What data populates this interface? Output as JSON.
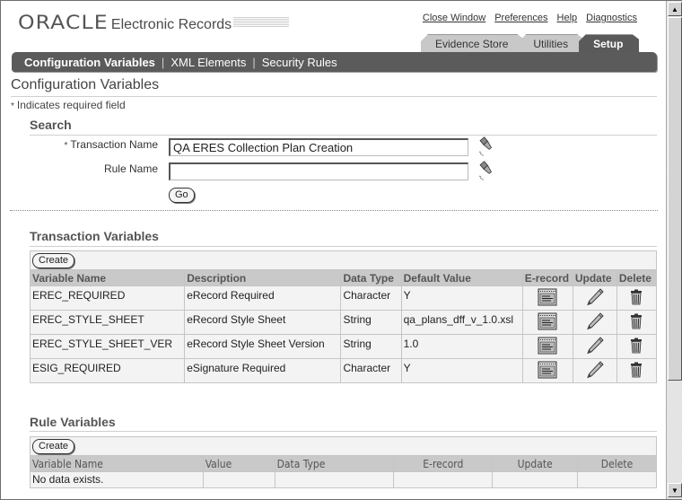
{
  "header": {
    "logo": "ORACLE",
    "app_name": "Electronic Records",
    "global_links": [
      "Close Window",
      "Preferences",
      "Help",
      "Diagnostics"
    ],
    "tabs": [
      {
        "label": "Evidence Store",
        "active": false
      },
      {
        "label": "Utilities",
        "active": false
      },
      {
        "label": "Setup",
        "active": true
      }
    ],
    "subtabs": [
      {
        "label": "Configuration Variables",
        "active": true
      },
      {
        "label": "XML Elements",
        "active": false
      },
      {
        "label": "Security Rules",
        "active": false
      }
    ],
    "separator": "|"
  },
  "page": {
    "title": "Configuration Variables",
    "required_star": "*",
    "required_note": "Indicates required field"
  },
  "search": {
    "heading": "Search",
    "transaction_name_label": "Transaction Name",
    "transaction_name_value": "QA ERES Collection Plan Creation",
    "rule_name_label": "Rule Name",
    "rule_name_value": "",
    "go_label": "Go"
  },
  "transaction_variables": {
    "heading": "Transaction Variables",
    "create_label": "Create",
    "columns": [
      "Variable Name",
      "Description",
      "Data Type",
      "Default Value",
      "E-record",
      "Update",
      "Delete"
    ],
    "rows": [
      {
        "name": "EREC_REQUIRED",
        "description": "eRecord Required",
        "data_type": "Character",
        "default_value": "Y"
      },
      {
        "name": "EREC_STYLE_SHEET",
        "description": "eRecord Style Sheet",
        "data_type": "String",
        "default_value": "qa_plans_dff_v_1.0.xsl"
      },
      {
        "name": "EREC_STYLE_SHEET_VER",
        "description": "eRecord Style Sheet Version",
        "data_type": "String",
        "default_value": "1.0"
      },
      {
        "name": "ESIG_REQUIRED",
        "description": "eSignature Required",
        "data_type": "Character",
        "default_value": "Y"
      }
    ]
  },
  "rule_variables": {
    "heading": "Rule Variables",
    "create_label": "Create",
    "columns": [
      "Variable Name",
      "Value",
      "Data Type",
      "E-record",
      "Update",
      "Delete"
    ],
    "empty_message": "No data exists."
  },
  "icons": {
    "search": "flashlight-icon",
    "erecord": "document-icon",
    "update": "pencil-icon",
    "delete": "trash-icon"
  }
}
